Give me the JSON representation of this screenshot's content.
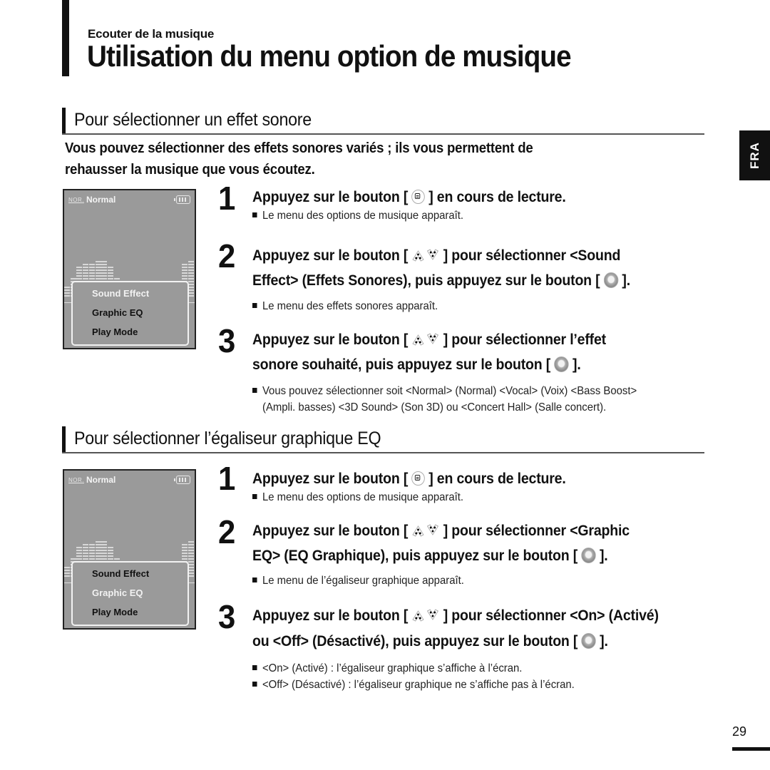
{
  "header": {
    "kicker": "Ecouter de la musique",
    "title": "Utilisation du menu option de musique"
  },
  "language_tab": "FRA",
  "sections": [
    {
      "heading": "Pour sélectionner un effet sonore",
      "intro": [
        "Vous pouvez sélectionner des effets sonores variés ; ils vous permettent de",
        "rehausser la musique que vous écoutez."
      ],
      "screen": {
        "ndr_label": "NOR.",
        "mode": "Normal",
        "menu_items": [
          "Sound Effect",
          "Graphic EQ",
          "Play Mode"
        ],
        "selected_index": 0
      },
      "steps": [
        {
          "num": "1",
          "lines": [
            [
              "Appuyez sur le bouton [ ",
              "menu-icon",
              " ] en cours de lecture."
            ]
          ],
          "notes": [
            "Le menu des options de musique apparaît."
          ]
        },
        {
          "num": "2",
          "lines": [
            [
              "Appuyez sur le bouton [ ",
              "up-down-icon",
              " ] pour sélectionner <Sound"
            ],
            [
              "Effect> (Effets Sonores), puis appuyez sur le bouton [ ",
              "ok-icon",
              " ]."
            ]
          ],
          "notes": [
            "Le menu des effets sonores apparaît."
          ]
        },
        {
          "num": "3",
          "lines": [
            [
              "Appuyez sur le bouton [ ",
              "up-down-icon",
              " ] pour sélectionner l’effet"
            ],
            [
              "sonore souhaité, puis appuyez sur le bouton [ ",
              "ok-icon",
              " ]."
            ]
          ],
          "notes": [
            "Vous pouvez sélectionner soit <Normal> (Normal) <Vocal> (Voix) <Bass Boost>",
            "(Ampli. basses) <3D Sound> (Son 3D) ou <Concert Hall> (Salle concert)."
          ]
        }
      ]
    },
    {
      "heading": "Pour sélectionner l’égaliseur graphique EQ",
      "screen": {
        "ndr_label": "NOR.",
        "mode": "Normal",
        "menu_items": [
          "Sound Effect",
          "Graphic EQ",
          "Play Mode"
        ],
        "selected_index": 1
      },
      "steps": [
        {
          "num": "1",
          "lines": [
            [
              "Appuyez sur le bouton [ ",
              "menu-icon",
              " ] en cours de lecture."
            ]
          ],
          "notes": [
            "Le menu des options de musique apparaît."
          ]
        },
        {
          "num": "2",
          "lines": [
            [
              "Appuyez sur le bouton [ ",
              "up-down-icon",
              " ] pour sélectionner <Graphic"
            ],
            [
              "EQ> (EQ Graphique), puis appuyez sur le bouton [ ",
              "ok-icon",
              " ]."
            ]
          ],
          "notes": [
            "Le menu de l’égaliseur graphique apparaît."
          ]
        },
        {
          "num": "3",
          "lines": [
            [
              "Appuyez sur le bouton [ ",
              "up-down-icon",
              " ] pour sélectionner <On> (Activé)"
            ],
            [
              "ou <Off> (Désactivé), puis appuyez sur le bouton [ ",
              "ok-icon",
              " ]."
            ]
          ],
          "notes": [
            "<On> (Activé) : l’égaliseur graphique s’affiche à l’écran.",
            "<Off> (Désactivé) : l’égaliseur graphique ne s’affiche pas à l’écran."
          ]
        }
      ]
    }
  ],
  "eq_levels": [
    4,
    7,
    11,
    12,
    12,
    13,
    13,
    11,
    7,
    2,
    0,
    0,
    0,
    0,
    4,
    5,
    3,
    0,
    0,
    12,
    13,
    11,
    10,
    8,
    6,
    6,
    6
  ],
  "page_number": "29"
}
